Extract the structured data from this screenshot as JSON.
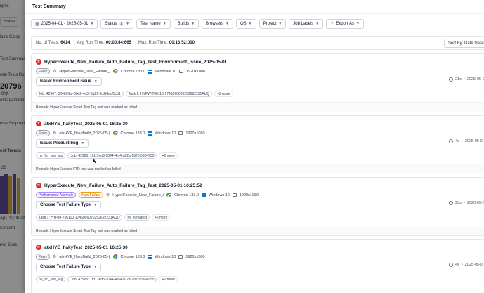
{
  "background": {
    "items": [
      "ights",
      "Home",
      "ilure Categ",
      "Test Summary",
      "otal Tests Run",
      "20796",
      "0",
      "0%",
      "ests Lambda E",
      "ests Stopped",
      "est Trends",
      "Apr, 12:00 am",
      "Content",
      "rror Stats"
    ],
    "y_axis": [
      "20",
      "0"
    ]
  },
  "drawer": {
    "title": "Test Summary",
    "filters": [
      {
        "label": "2025-04-01 - 2025-05-01",
        "icon": "calendar-icon"
      },
      {
        "label": "Status",
        "count": "1"
      },
      {
        "label": "Test Name"
      },
      {
        "label": "Builds"
      },
      {
        "label": "Browsers"
      },
      {
        "label": "OS"
      },
      {
        "label": "Project"
      },
      {
        "label": "Job Labels"
      },
      {
        "label": "Export As",
        "icon": "upload-icon"
      }
    ],
    "stats": {
      "tests_label": "No. of Tests:",
      "tests_value": "6414",
      "avg_label": "Avg Run Time:",
      "avg_value": "00:00:44:665",
      "max_label": "Max. Run Time:",
      "max_value": "00:13:52:000",
      "sort_label": "Sort By: Date Descen"
    },
    "cards": [
      {
        "title": "HyperExecute_New_Failure_Auto_Failure_Tag_Test_Environment_Issue_2025-05-01",
        "badges": [
          "Flaky"
        ],
        "build": "HyperExecute_New_Failure_i",
        "browser": "Chrome 133.0",
        "os": "Windows 10",
        "resolution": "1920x1080",
        "issue": "Issue: Environment issue",
        "tags": [
          "Job: 42967: 5ff489fba-80e2-4c3f-8a29-3d2f4acf5c51",
          "Task 1: HYPW-706110-1746096020252692231AUQ"
        ],
        "more": "+2 more",
        "remark": "Remark: HyperExecute Smart Test Tag test was marked as failed",
        "duration": "21s",
        "date": "2025-05-0"
      },
      {
        "title": "atxHYE_flakyTest_2025-05-01 16:25:30",
        "badges": [
          "Flaky"
        ],
        "build": "atxHYE_flakyBuild_2025-05-(",
        "browser": "Chrome 133.0",
        "os": "Windows 10",
        "resolution": "1920x1080",
        "issue": "Issue: Product bug",
        "tags": [
          "he_ftd_test_tag",
          "Job: 42965: 1fd17ed3-1044-4fd4-a02a-1875f5304955"
        ],
        "more": "+2 more",
        "remark": "Remark: HyperExecute FTD test was marked as failed",
        "duration": "4s",
        "date": "2025-05-0"
      },
      {
        "title": "HyperExecute_New_Failure_Auto_Failure_Tag_Test_2025-05-01 16:25:52",
        "badges": [
          "Performance Anomaly",
          "New Failure"
        ],
        "build": "HyperExecute_New_Failure_i",
        "browser": "Chrome 133.0",
        "os": "Windows 10",
        "resolution": "1920x1080",
        "issue": "Choose Test Failure Type",
        "tags": [
          "Task 1: HYPW-706110-1746096020252692231AUQ",
          "he_runlatest"
        ],
        "more": "+2 more",
        "remark": "Remark: HyperExecute Smart Test Tag test was marked as failed",
        "duration": "23s",
        "date": "2025-05-0"
      },
      {
        "title": "atxHYE_flakyTest_2025-05-01 16:25:30",
        "badges": [
          "Flaky"
        ],
        "build": "atxHYE_flakyBuild_2025-05-(",
        "browser": "Chrome 133.0",
        "os": "Windows 10",
        "resolution": "1920x1080",
        "issue": "Choose Test Failure Type",
        "tags": [
          "he_ftd_test_tag",
          "Job: 42965: 1fd17ed3-1044-4fd4-a02a-1875f5304955"
        ],
        "more": "+2 more",
        "remark": "",
        "duration": "4s",
        "date": "2025-05-0"
      }
    ]
  }
}
